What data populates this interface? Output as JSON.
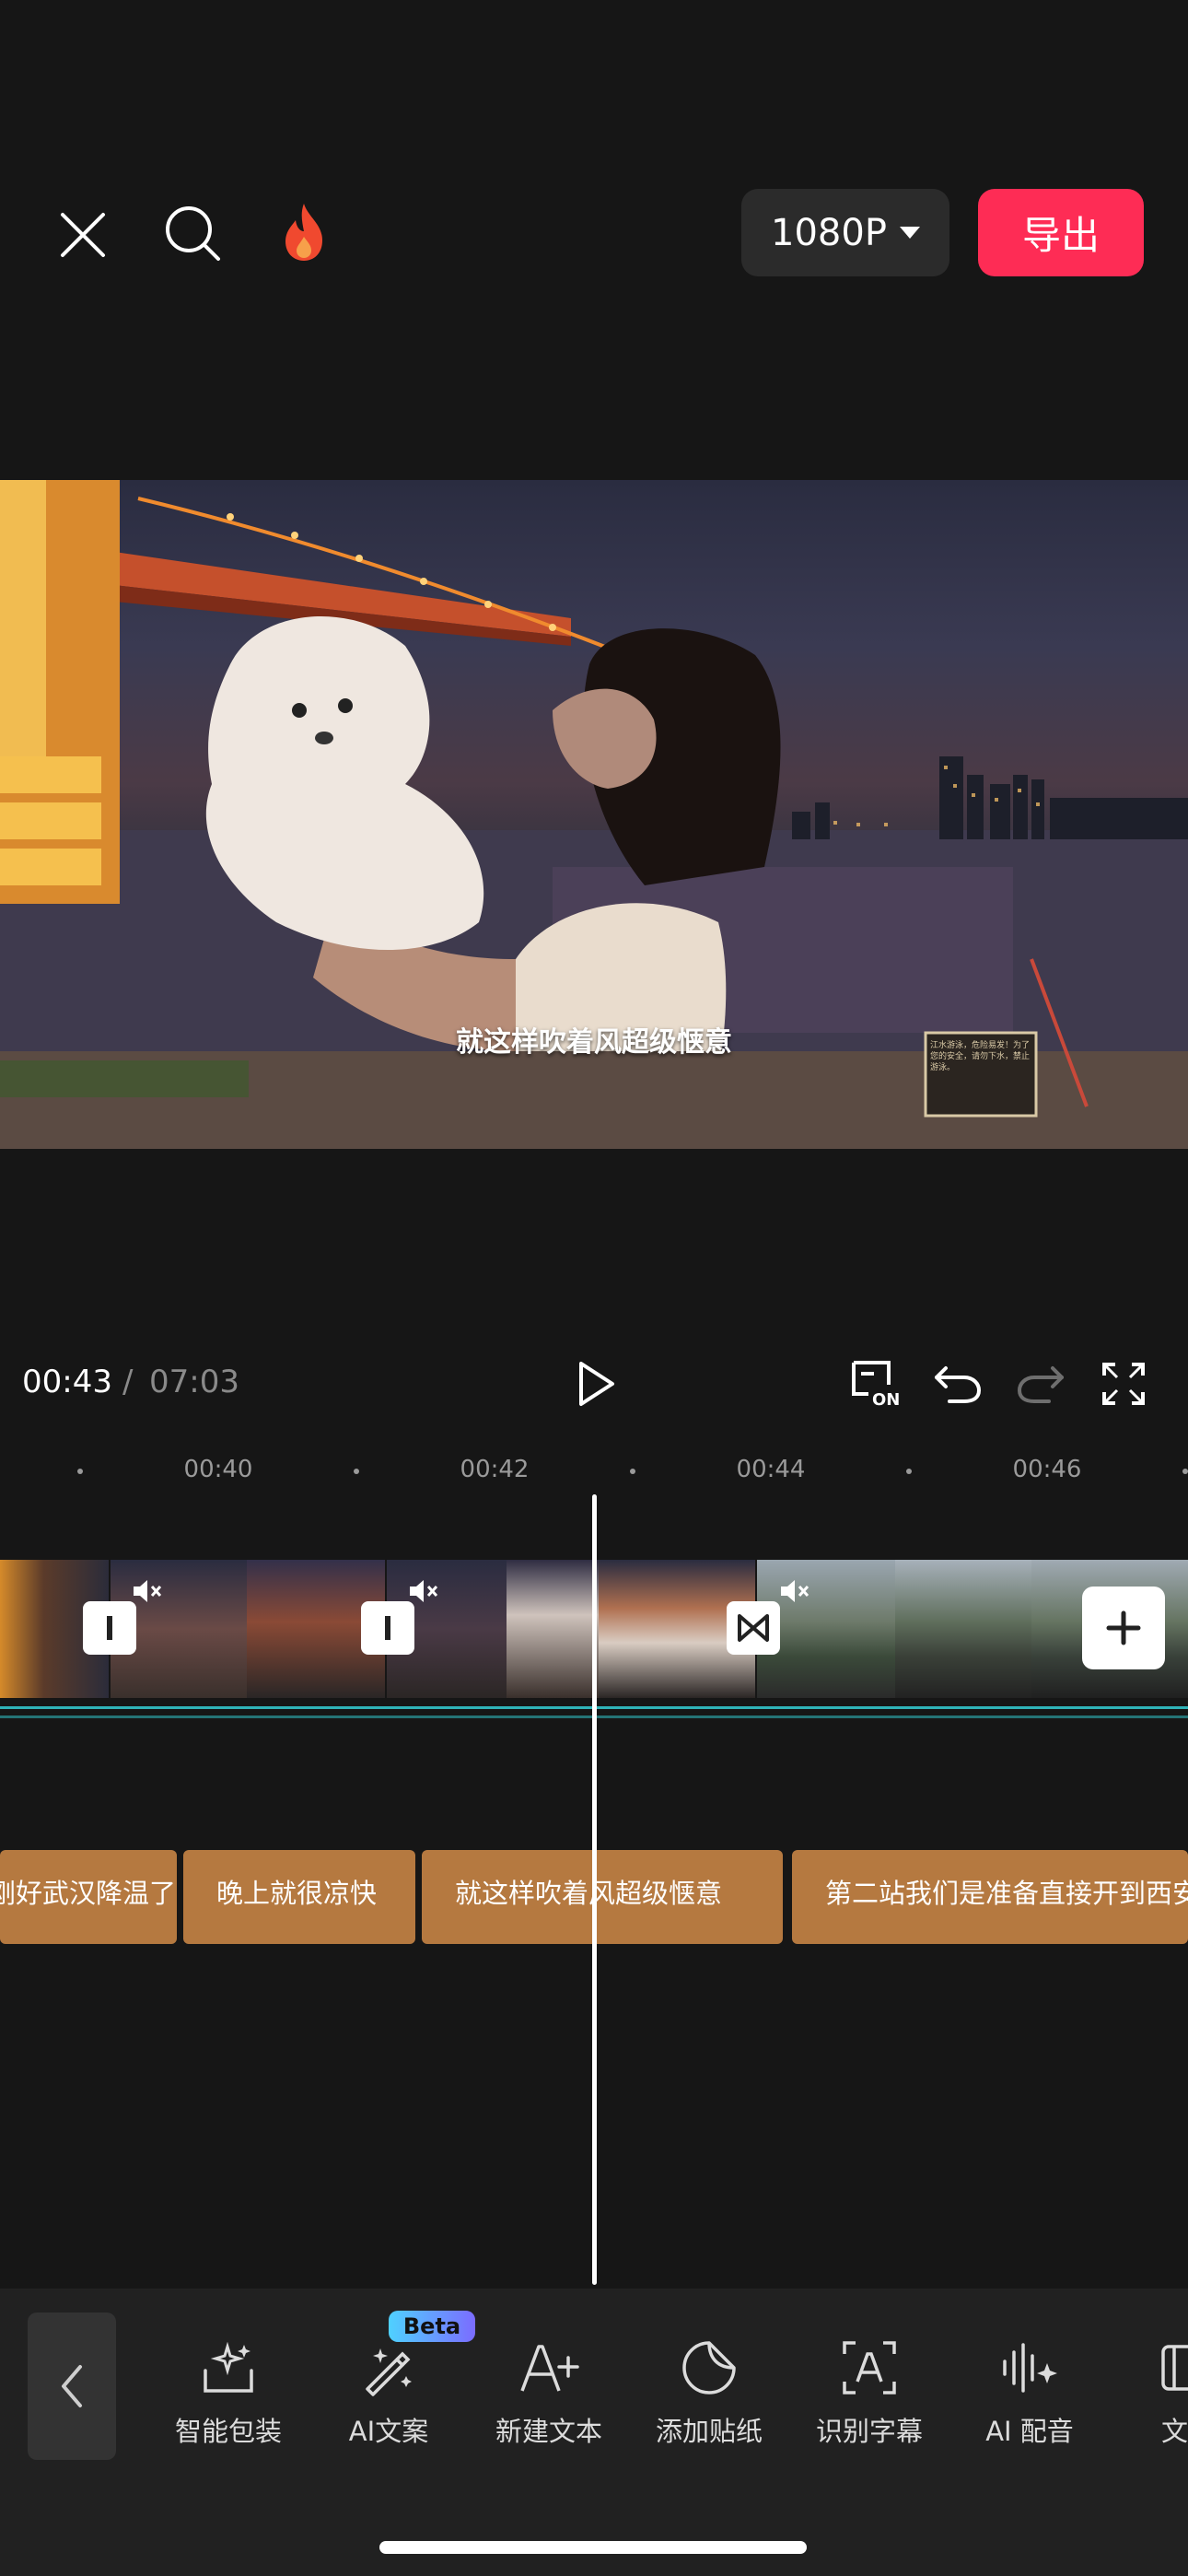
{
  "topbar": {
    "close_icon": "close-icon",
    "search_icon": "search-icon",
    "hot_icon": "flame-icon",
    "resolution": "1080P",
    "export_label": "导出",
    "accent_color": "#fe2c55"
  },
  "preview": {
    "subtitle": "就这样吹着风超级惬意",
    "sign_text": "江水游泳，危险易发！为了您的安全，请勿下水，禁止游泳。"
  },
  "playback": {
    "current_time": "00:43",
    "separator": "/",
    "total_time": "07:03"
  },
  "ruler": {
    "labels": [
      "00:40",
      "00:42",
      "00:44",
      "00:46"
    ]
  },
  "text_track": {
    "clips": [
      "刚好武汉降温了",
      "晚上就很凉快",
      "就这样吹着风超级惬意",
      "第二站我们是准备直接开到西安"
    ]
  },
  "toolbar": {
    "badge": "Beta",
    "items": [
      {
        "label": "智能包装",
        "icon": "sparkle-box-icon"
      },
      {
        "label": "AI文案",
        "icon": "magic-wand-icon"
      },
      {
        "label": "新建文本",
        "icon": "add-text-icon"
      },
      {
        "label": "添加贴纸",
        "icon": "sticker-icon"
      },
      {
        "label": "识别字幕",
        "icon": "caption-recognize-icon"
      },
      {
        "label": "AI 配音",
        "icon": "ai-voice-icon"
      },
      {
        "label": "文字",
        "icon": "text-template-icon"
      }
    ]
  }
}
